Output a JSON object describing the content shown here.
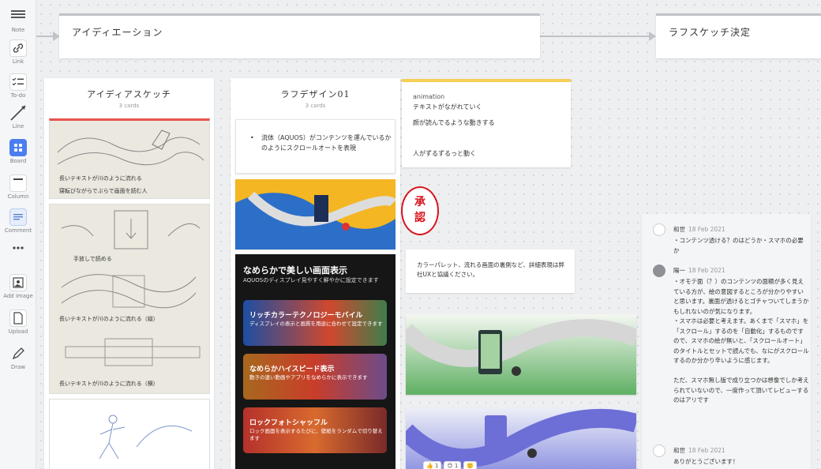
{
  "toolbar": {
    "items": [
      {
        "label": "Note",
        "icon": "note-icon"
      },
      {
        "label": "Link",
        "icon": "link-icon"
      },
      {
        "label": "To-do",
        "icon": "todo-icon"
      },
      {
        "label": "Line",
        "icon": "line-icon"
      },
      {
        "label": "Board",
        "icon": "board-icon"
      },
      {
        "label": "Column",
        "icon": "column-icon"
      },
      {
        "label": "Comment",
        "icon": "comment-icon"
      },
      {
        "label": "",
        "icon": "more-icon"
      },
      {
        "label": "Add image",
        "icon": "add-image-icon"
      },
      {
        "label": "Upload",
        "icon": "upload-icon"
      },
      {
        "label": "Draw",
        "icon": "draw-icon"
      }
    ]
  },
  "headers": {
    "ideation": "アイディエーション",
    "rough_decision": "ラフスケッチ決定"
  },
  "col1": {
    "title": "アイディアスケッチ",
    "count": "3 cards",
    "sketch1_cap1": "長いテキストが川のように流れる",
    "sketch1_cap2": "寝転びながらでぶらで画面を読む人",
    "sketch2_cap1": "手放しで読める",
    "sketch2_cap2": "長いテキストが川のように流れる（縦）",
    "sketch2_cap3": "長いテキストが川のように流れる（横）"
  },
  "col2": {
    "title": "ラフデザイン01",
    "count": "3 cards",
    "bullet": "流体（AQUOS）がコンテンツを運んでいるかのようにスクロールオートを表現",
    "dark": {
      "title": "なめらかで美しい画面表示",
      "subtitle": "AQUOSのディスプレイ見やすく鮮やかに設定できます",
      "features": [
        {
          "title": "リッチカラーテクノロジーモバイル",
          "desc": "ディスプレイの表示と画質を用途に合わせて設定できます"
        },
        {
          "title": "なめらかハイスピード表示",
          "desc": "動きの速い動画やアプリをなめらかに表示できます"
        },
        {
          "title": "ロックフォトシャッフル",
          "desc": "ロック画面を表示するたびに、壁紙をランダムで切り替えます"
        }
      ]
    }
  },
  "note": {
    "label": "animation",
    "line1": "テキストがながれていく",
    "line2": "颜が読んでるような動きする",
    "line3": "人がずるずるっと動く"
  },
  "stamp": {
    "line1": "承",
    "line2": "認"
  },
  "palette_note": "カラーパレット、流れる画面の裏側など、詳細表現は弊社UXと協議ください。",
  "reactions": [
    "👍 1",
    "😊 1",
    "🙂"
  ],
  "comments": [
    {
      "name": "和世",
      "date": "18 Feb 2021",
      "body": "・コンテンツ透ける？のはどうか・スマホの必要か"
    },
    {
      "name": "陽一",
      "date": "18 Feb 2021",
      "body": "・オモテ面（？）のコンテンツの面積が多く見えている方が、絵の意図するところが分かりやすいと思います。裏面が透けるとゴチャついてしまうかもしれないのが気になります。\n・スマホは必要と考えます。あくまで「スマホ」を「スクロール」するのを「自動化」するものですので、スマホの絵が無いと、「スクロールオート」のタイトルとセットで読んでも、なにがスクロールするのか分かり辛いように感じます。\n\nただ、スマホ無し版で成り立つかは想像でしか考えられていないので、一度作って頂いてレビューするのはアリです"
    },
    {
      "name": "和世",
      "date": "18 Feb 2021",
      "body": "ありがとうございます！"
    }
  ]
}
